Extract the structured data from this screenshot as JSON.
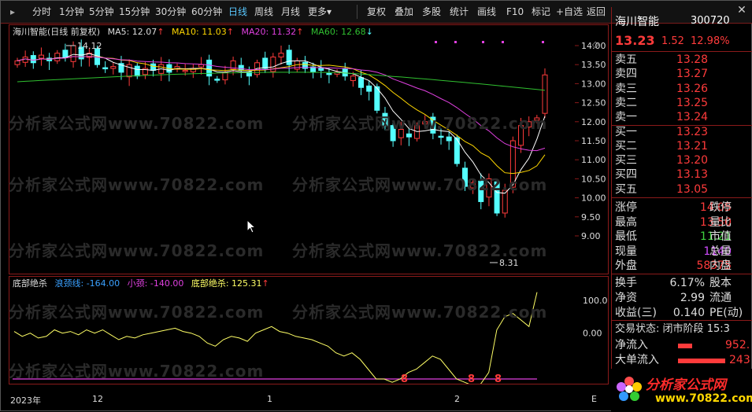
{
  "toolbar": {
    "items": [
      "分时",
      "1分钟",
      "5分钟",
      "15分钟",
      "30分钟",
      "60分钟",
      "日线",
      "周线",
      "月线",
      "更多"
    ],
    "selected": "日线",
    "more_arrow": "▾",
    "right_items": [
      "复权",
      "叠加",
      "多股",
      "统计",
      "画线",
      "F10",
      "标记",
      "+自选",
      "返回"
    ],
    "close": "✕"
  },
  "main_legend": {
    "title": "海川智能(日线 前复权)",
    "ma5": "MA5: 12.07",
    "ma10": "MA10: 11.03",
    "ma20": "MA20: 11.32",
    "ma60": "MA60: 12.68",
    "arrow_up": "↑",
    "arrow_down": "↓"
  },
  "main_axis": {
    "ticks": [
      "14.00",
      "13.50",
      "13.00",
      "12.50",
      "12.00",
      "11.50",
      "11.00",
      "10.50",
      "10.00",
      "9.50",
      "9.00"
    ],
    "high_label": "14.12",
    "low_label": "8.31"
  },
  "sub_legend": {
    "title": "底部绝杀",
    "line1": "浪颈线: -164.00",
    "line2": "小颈: -140.00",
    "line3": "底部绝杀: 125.31",
    "arrow": "↑",
    "ticks": [
      "100.0",
      "0.00"
    ],
    "signal": "8"
  },
  "x_axis": {
    "labels": [
      "2023年",
      "12",
      "1",
      "2",
      "E"
    ]
  },
  "watermark": "分析家公式网www.70822.com",
  "quote": {
    "name": "海川智能",
    "code": "300720",
    "price": "13.23",
    "change": "1.52",
    "change_pct": "12.98%",
    "asks": [
      {
        "label": "卖五",
        "price": "13.28"
      },
      {
        "label": "卖四",
        "price": "13.27"
      },
      {
        "label": "卖三",
        "price": "13.26"
      },
      {
        "label": "卖二",
        "price": "13.25"
      },
      {
        "label": "卖一",
        "price": "13.24"
      }
    ],
    "bids": [
      {
        "label": "买一",
        "price": "13.23"
      },
      {
        "label": "买二",
        "price": "13.21"
      },
      {
        "label": "买三",
        "price": "13.20"
      },
      {
        "label": "买四",
        "price": "13.13"
      },
      {
        "label": "买五",
        "price": "13.05"
      }
    ],
    "stats": [
      {
        "l": "涨停",
        "v": "14.05",
        "r": "跌停",
        "vc": "#ff3b3b"
      },
      {
        "l": "最高",
        "v": "13.50",
        "r": "量比",
        "vc": "#ff3b3b"
      },
      {
        "l": "最低",
        "v": "11.21",
        "r": "市值",
        "vc": "#3fd23f"
      },
      {
        "l": "现量",
        "v": "1140",
        "r": "总量",
        "vc": "#d04bff"
      },
      {
        "l": "外盘",
        "v": "58375",
        "r": "内盘",
        "vc": "#ff3b3b"
      }
    ],
    "stats2": [
      {
        "l": "换手",
        "v": "6.17%",
        "r": "股本"
      },
      {
        "l": "净资",
        "v": "2.99",
        "r": "流通"
      },
      {
        "l": "收益(三)",
        "v": "0.140",
        "r": "PE(动)"
      }
    ],
    "trade_status_label": "交易状态:",
    "trade_status": "闭市阶段",
    "trade_time": "15:3",
    "net_inflow_label": "净流入",
    "net_inflow": "952.",
    "big_inflow_label": "大单流入",
    "big_inflow": "243"
  },
  "ad": {
    "text": "分析家公式网",
    "url": "www.70822.com"
  },
  "colors": {
    "up": "#ff3b3b",
    "down": "#54ffff",
    "ma5": "#ffffff",
    "ma10": "#ffd700",
    "ma20": "#e040e0",
    "ma60": "#30c030",
    "sub_line": "#ffff66",
    "sub_h1": "#e040e0",
    "sub_h2": "#3aa0ff"
  }
}
